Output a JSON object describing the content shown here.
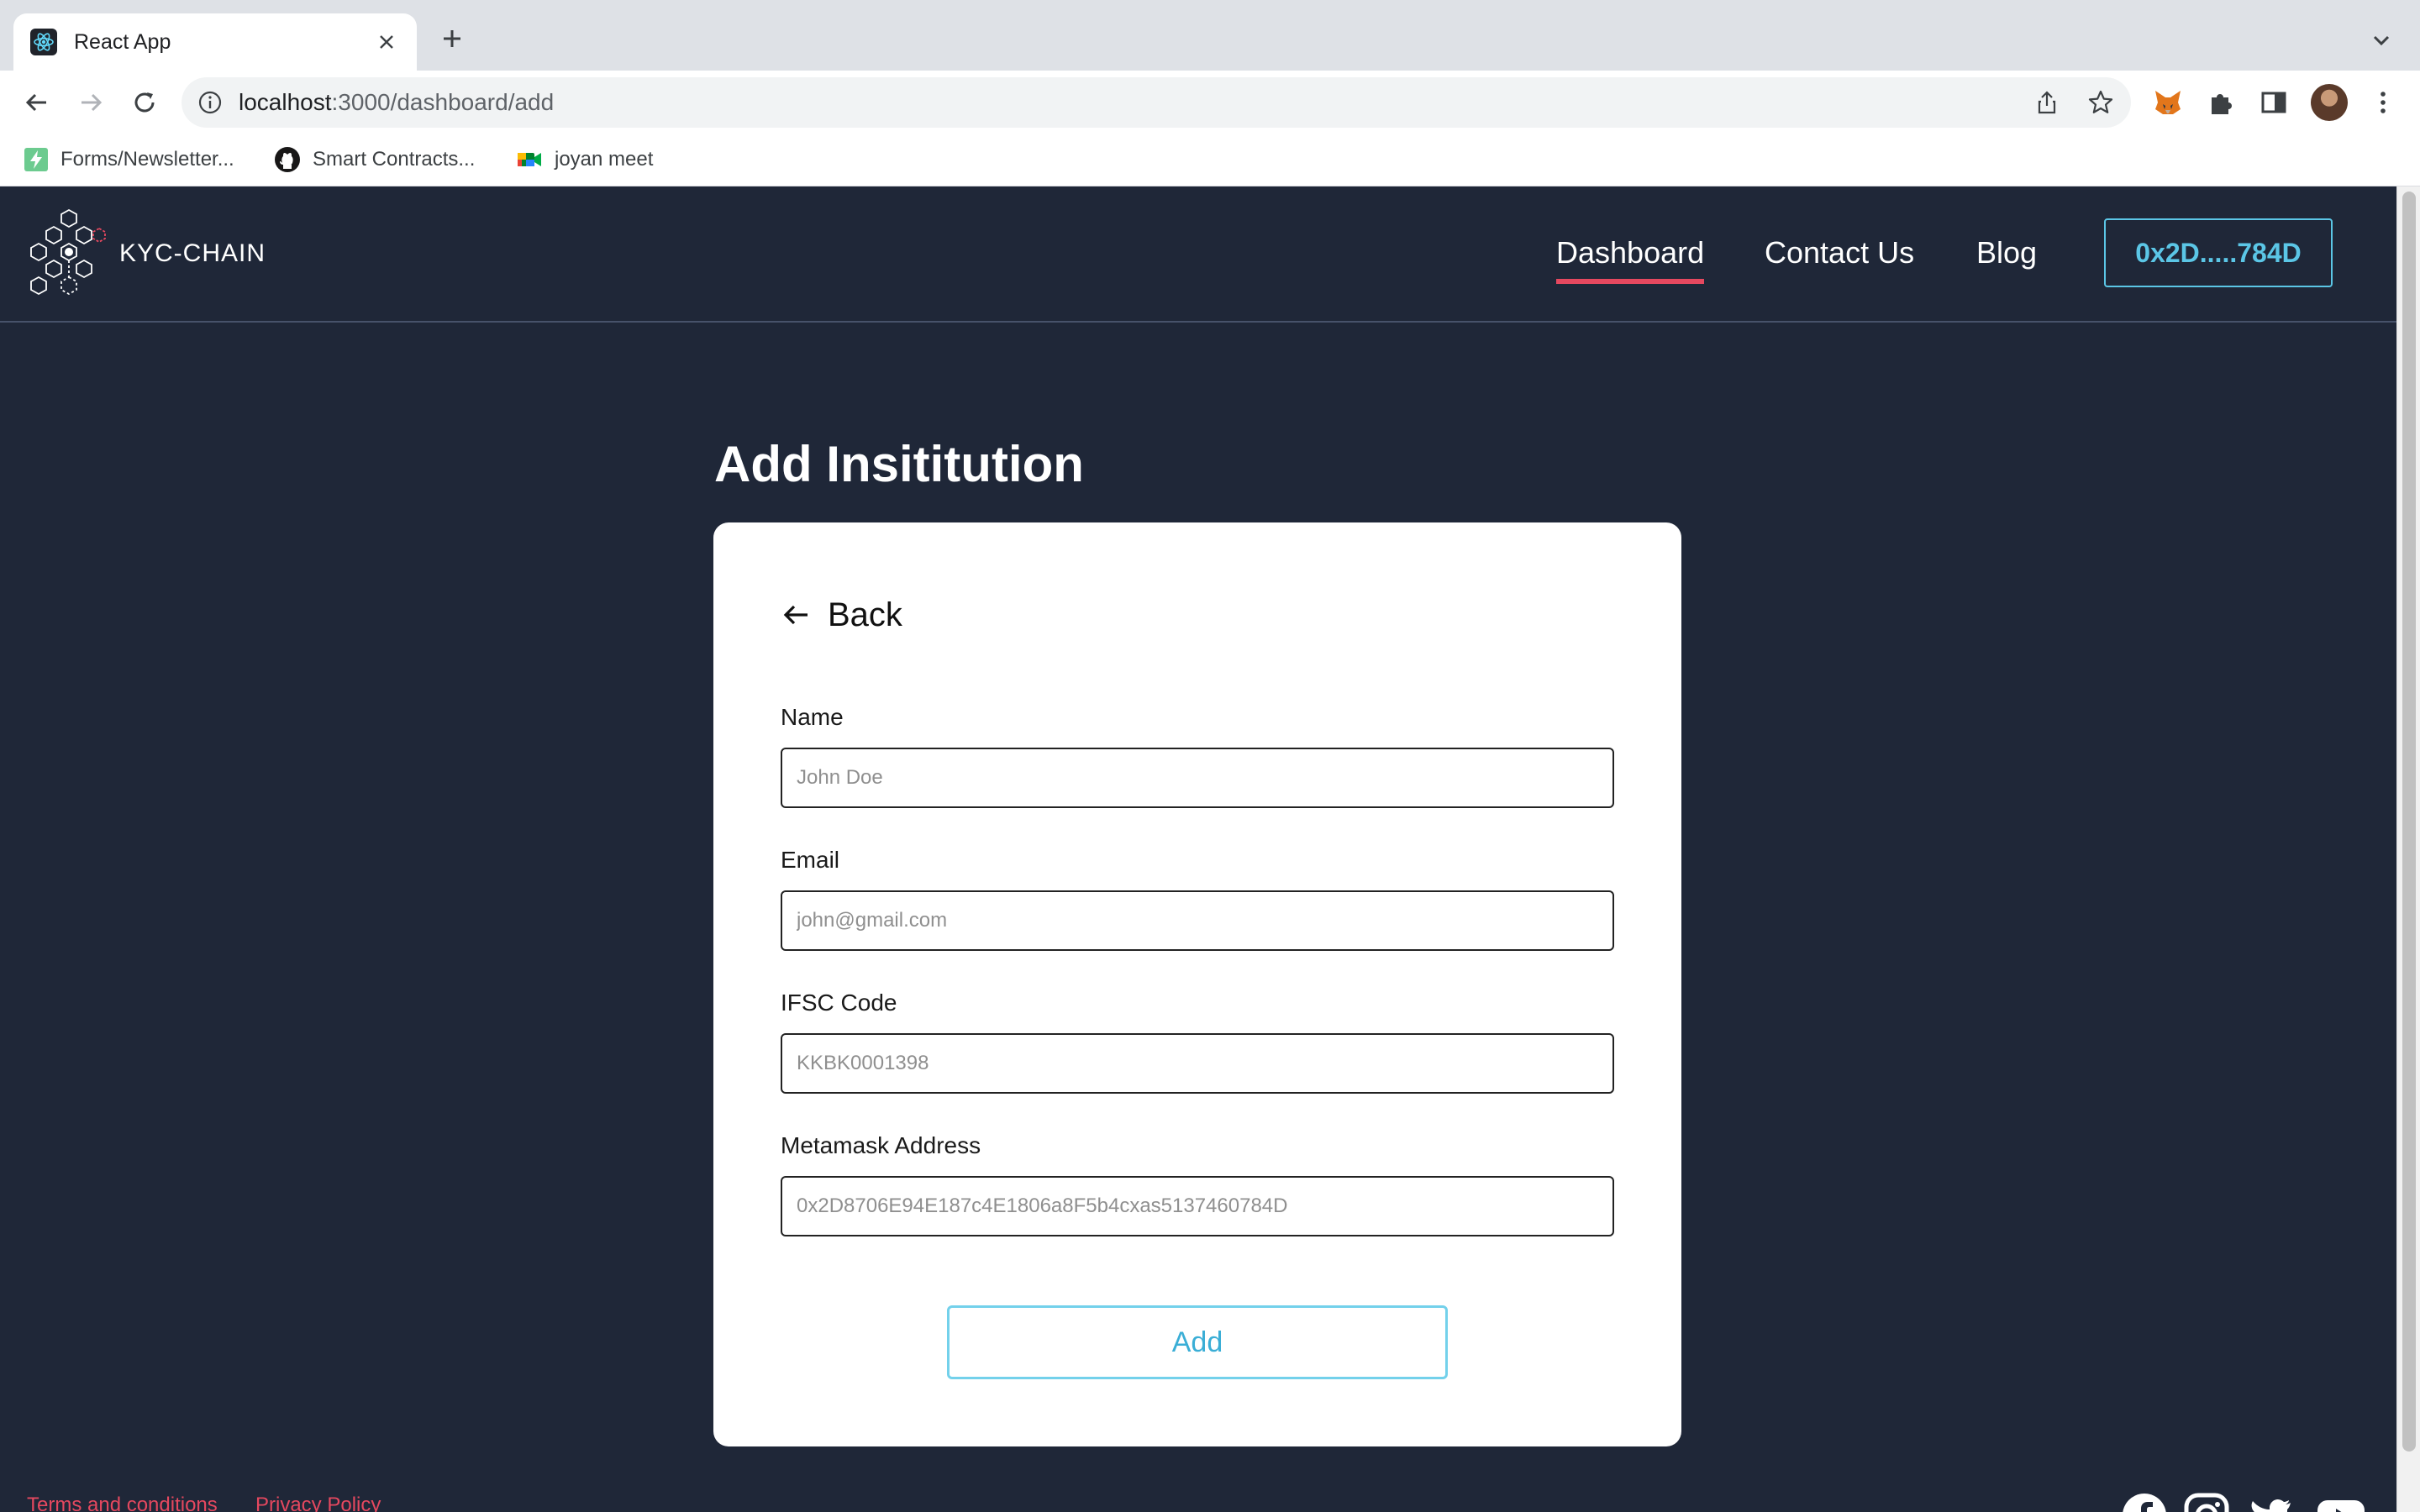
{
  "browser": {
    "tab_title": "React App",
    "url_host": "localhost",
    "url_path": ":3000/dashboard/add",
    "bookmarks": [
      {
        "label": "Forms/Newsletter..."
      },
      {
        "label": "Smart Contracts..."
      },
      {
        "label": "joyan meet"
      }
    ]
  },
  "header": {
    "logo_text": "KYC-CHAIN",
    "nav": [
      {
        "label": "Dashboard",
        "active": true
      },
      {
        "label": "Contact Us"
      },
      {
        "label": "Blog"
      }
    ],
    "wallet_label": "0x2D.....784D"
  },
  "main": {
    "title": "Add Insititution",
    "back_label": "Back",
    "fields": [
      {
        "label": "Name",
        "placeholder": "John Doe"
      },
      {
        "label": "Email",
        "placeholder": "john@gmail.com"
      },
      {
        "label": "IFSC Code",
        "placeholder": "KKBK0001398"
      },
      {
        "label": "Metamask Address",
        "placeholder": "0x2D8706E94E187c4E1806a8F5b4cxas5137460784D"
      }
    ],
    "submit_label": "Add"
  },
  "footer": {
    "links": [
      {
        "label": "Terms and conditions"
      },
      {
        "label": "Privacy Policy"
      }
    ],
    "social_icons": [
      "facebook-icon",
      "instagram-icon",
      "twitter-icon",
      "youtube-icon"
    ]
  },
  "colors": {
    "page_bg": "#1f2738",
    "accent_cyan": "#5bc6e6",
    "accent_red": "#e5485f"
  }
}
